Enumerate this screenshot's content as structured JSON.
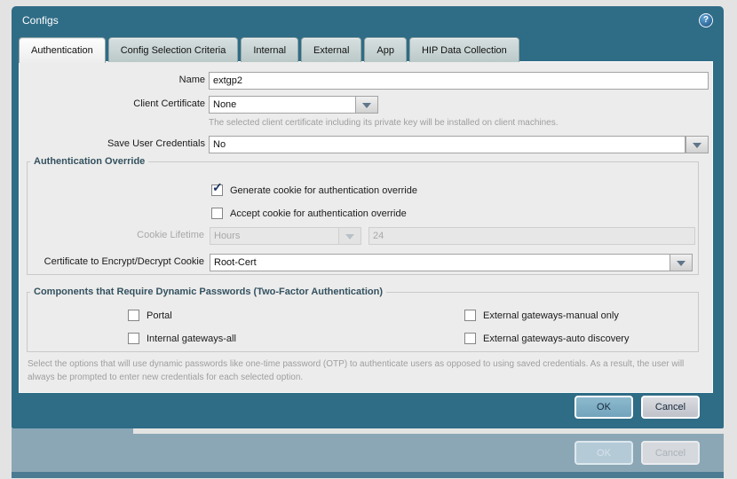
{
  "window": {
    "title": "Configs",
    "help_glyph": "?"
  },
  "tabs": [
    {
      "label": "Authentication",
      "active": true
    },
    {
      "label": "Config Selection Criteria",
      "active": false
    },
    {
      "label": "Internal",
      "active": false
    },
    {
      "label": "External",
      "active": false
    },
    {
      "label": "App",
      "active": false
    },
    {
      "label": "HIP Data Collection",
      "active": false
    }
  ],
  "form": {
    "name": {
      "label": "Name",
      "value": "extgp2"
    },
    "client_certificate": {
      "label": "Client Certificate",
      "value": "None",
      "help": "The selected client certificate including its private key will be installed on client machines."
    },
    "save_user_credentials": {
      "label": "Save User Credentials",
      "value": "No"
    },
    "authentication_override": {
      "legend": "Authentication Override",
      "generate_cookie": {
        "label": "Generate cookie for authentication override",
        "checked": true,
        "check_glyph": "✓"
      },
      "accept_cookie": {
        "label": "Accept cookie for authentication override",
        "checked": false
      },
      "cookie_lifetime": {
        "label": "Cookie Lifetime",
        "unit": "Hours",
        "value": "24",
        "disabled": true
      },
      "encrypt_certificate": {
        "label": "Certificate to Encrypt/Decrypt Cookie",
        "value": "Root-Cert"
      }
    },
    "two_factor": {
      "legend": "Components that Require Dynamic Passwords (Two-Factor Authentication)",
      "options": [
        {
          "label": "Portal",
          "checked": false
        },
        {
          "label": "Internal gateways-all",
          "checked": false
        },
        {
          "label": "External gateways-manual only",
          "checked": false
        },
        {
          "label": "External gateways-auto discovery",
          "checked": false
        }
      ]
    },
    "footnote": "Select the options that will use dynamic passwords like one-time password (OTP) to authenticate users as opposed to using saved credentials. As a result, the user will always be prompted to enter new credentials for each selected option."
  },
  "footer": {
    "ok_label": "OK",
    "cancel_label": "Cancel"
  },
  "background_window": {
    "ok_label": "OK",
    "cancel_label": "Cancel"
  },
  "colors": {
    "titlebar_teal": "#2f6c86",
    "content_bg": "#ececec",
    "ok_button_blue": "#79a9c0",
    "masked_dialog_blue": "#8ba7b6",
    "page_bg": "#e3e3e3"
  }
}
